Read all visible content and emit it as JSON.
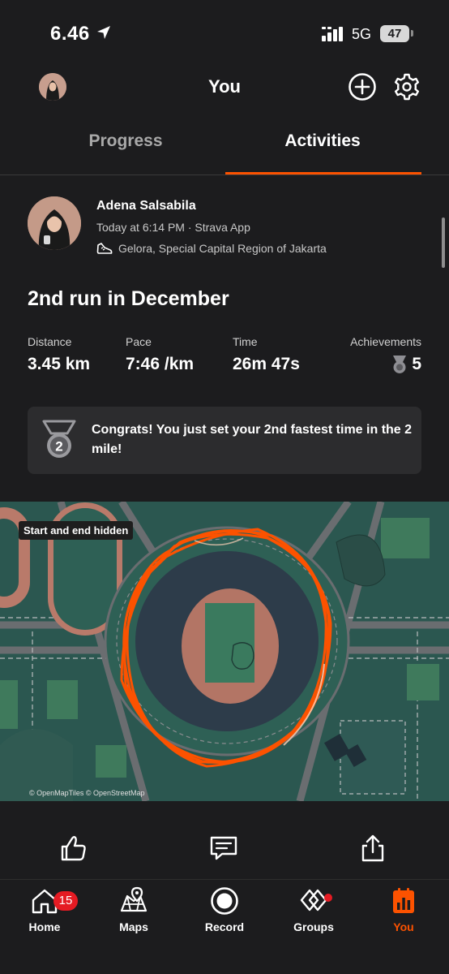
{
  "status_bar": {
    "time": "6.46",
    "network": "5G",
    "battery": "47"
  },
  "header": {
    "title": "You"
  },
  "tabs": [
    {
      "label": "Progress",
      "active": false
    },
    {
      "label": "Activities",
      "active": true
    }
  ],
  "activity": {
    "athlete": "Adena Salsabila",
    "meta": "Today at 6:14 PM · Strava App",
    "location": "Gelora, Special Capital Region of Jakarta",
    "title": "2nd run in December",
    "stats": {
      "distance": {
        "label": "Distance",
        "value": "3.45 km"
      },
      "pace": {
        "label": "Pace",
        "value": "7:46 /km"
      },
      "time": {
        "label": "Time",
        "value": "26m 47s"
      },
      "achievements": {
        "label": "Achievements",
        "value": "5"
      }
    },
    "congrats": {
      "text": "Congrats! You just set your 2nd fastest time in the 2 mile!",
      "medal_rank": "2"
    }
  },
  "map": {
    "badge": "Start and end hidden",
    "credit": "© OpenMapTiles © OpenStreetMap",
    "route_color": "#fc5200"
  },
  "nav": {
    "items": [
      {
        "label": "Home",
        "icon": "home-icon",
        "badge": "15"
      },
      {
        "label": "Maps",
        "icon": "maps-icon"
      },
      {
        "label": "Record",
        "icon": "record-icon"
      },
      {
        "label": "Groups",
        "icon": "groups-icon"
      },
      {
        "label": "You",
        "icon": "you-icon",
        "active": true
      }
    ]
  },
  "colors": {
    "accent": "#fc5200",
    "background": "#1c1c1e",
    "badge": "#e51b23"
  }
}
